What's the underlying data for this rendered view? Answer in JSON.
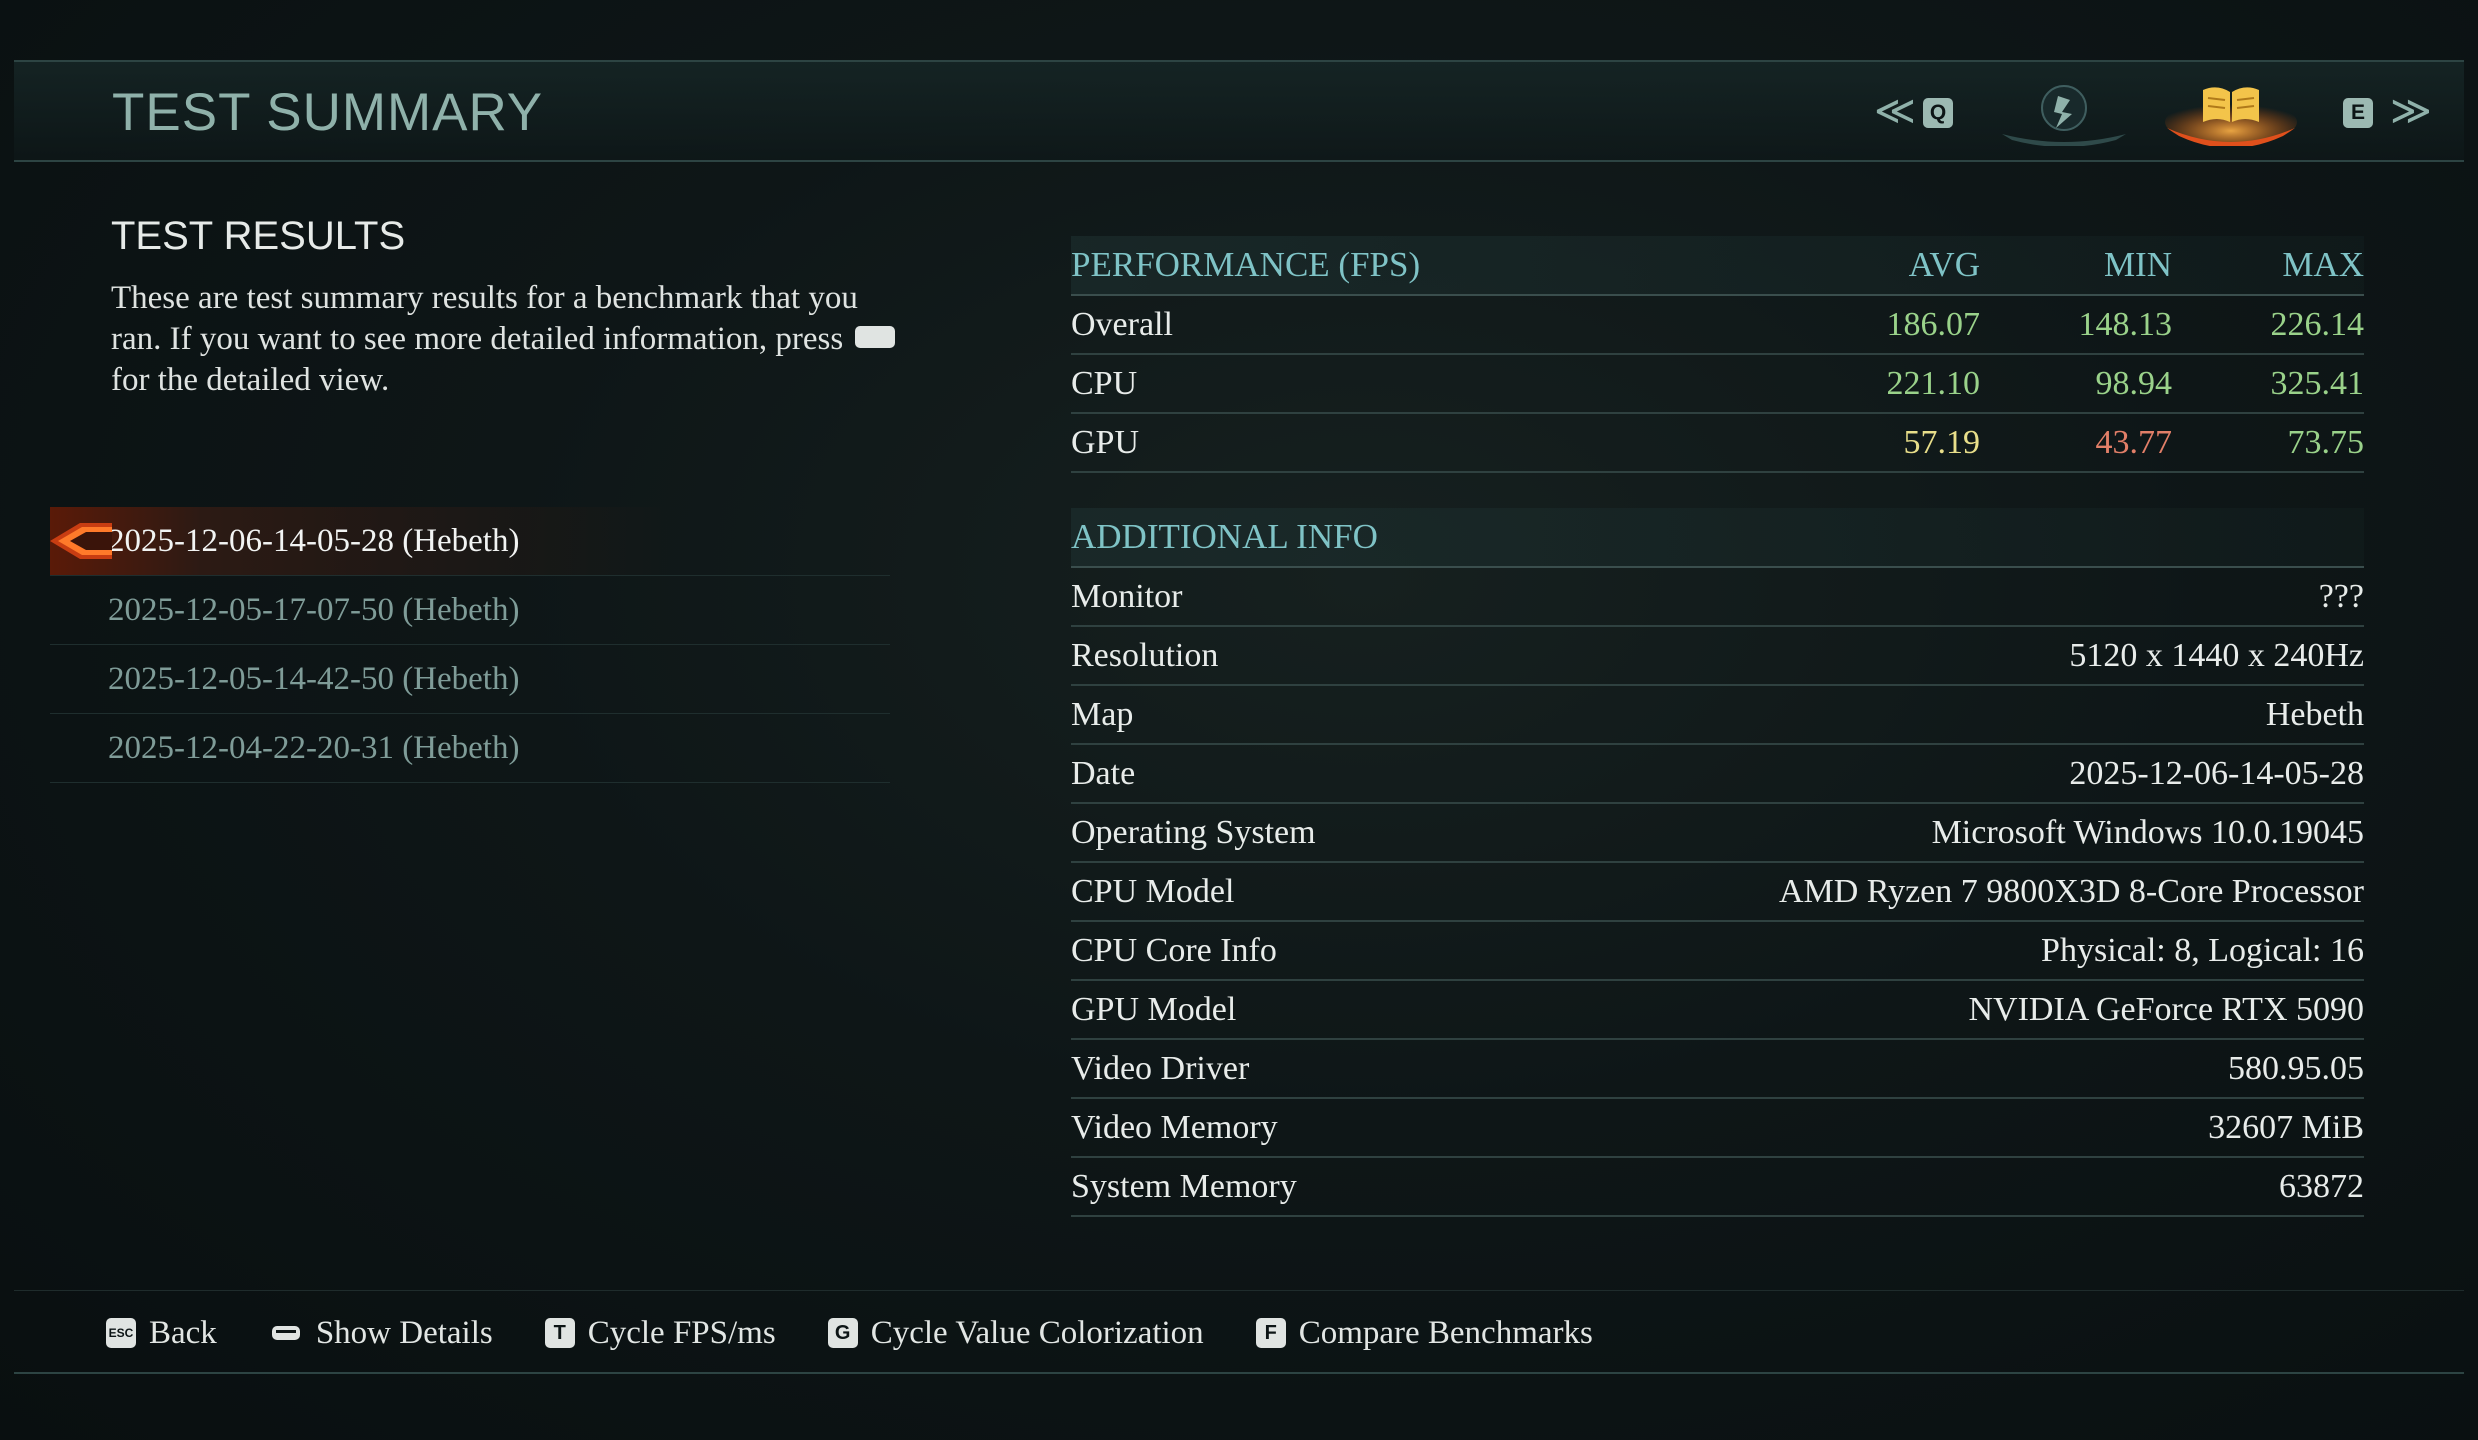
{
  "header": {
    "title": "TEST SUMMARY",
    "prev_key": "Q",
    "next_key": "E",
    "tabs": [
      {
        "icon": "crest-icon",
        "active": false
      },
      {
        "icon": "book-icon",
        "active": true
      }
    ]
  },
  "results": {
    "title": "TEST RESULTS",
    "description_part1": "These are test summary results for a benchmark that you ran. If you want to see more detailed information, press",
    "description_part2": "for the detailed view.",
    "benchmarks": [
      {
        "label": "2025-12-06-14-05-28 (Hebeth)",
        "selected": true
      },
      {
        "label": "2025-12-05-17-07-50 (Hebeth)",
        "selected": false
      },
      {
        "label": "2025-12-05-14-42-50 (Hebeth)",
        "selected": false
      },
      {
        "label": "2025-12-04-22-20-31 (Hebeth)",
        "selected": false
      }
    ]
  },
  "performance": {
    "title": "PERFORMANCE (FPS)",
    "columns": [
      "AVG",
      "MIN",
      "MAX"
    ],
    "rows": [
      {
        "label": "Overall",
        "avg": "186.07",
        "min": "148.13",
        "max": "226.14",
        "colors": [
          "green",
          "green",
          "green"
        ]
      },
      {
        "label": "CPU",
        "avg": "221.10",
        "min": "98.94",
        "max": "325.41",
        "colors": [
          "green",
          "green",
          "green"
        ]
      },
      {
        "label": "GPU",
        "avg": "57.19",
        "min": "43.77",
        "max": "73.75",
        "colors": [
          "yellow",
          "red",
          "green"
        ]
      }
    ]
  },
  "additional": {
    "title": "ADDITIONAL INFO",
    "rows": [
      {
        "label": "Monitor",
        "value": "???"
      },
      {
        "label": "Resolution",
        "value": "5120 x 1440 x 240Hz"
      },
      {
        "label": "Map",
        "value": "Hebeth"
      },
      {
        "label": "Date",
        "value": "2025-12-06-14-05-28"
      },
      {
        "label": "Operating System",
        "value": "Microsoft Windows 10.0.19045"
      },
      {
        "label": "CPU Model",
        "value": "AMD Ryzen 7 9800X3D 8-Core Processor"
      },
      {
        "label": "CPU Core Info",
        "value": "Physical: 8, Logical: 16"
      },
      {
        "label": "GPU Model",
        "value": "NVIDIA GeForce RTX 5090"
      },
      {
        "label": "Video Driver",
        "value": "580.95.05"
      },
      {
        "label": "Video Memory",
        "value": "32607 MiB"
      },
      {
        "label": "System Memory",
        "value": "63872"
      }
    ]
  },
  "footer": {
    "actions": [
      {
        "key": "ESC",
        "label": "Back"
      },
      {
        "key": "",
        "label": "Show Details",
        "icon": "controller-button-icon"
      },
      {
        "key": "T",
        "label": "Cycle FPS/ms"
      },
      {
        "key": "G",
        "label": "Cycle Value Colorization"
      },
      {
        "key": "F",
        "label": "Compare Benchmarks"
      }
    ]
  },
  "colors": {
    "accent_teal": "#7fc3c6",
    "good": "#9ad28a",
    "warn": "#e8de8a",
    "bad": "#e27f68",
    "selection": "#e0501c"
  }
}
